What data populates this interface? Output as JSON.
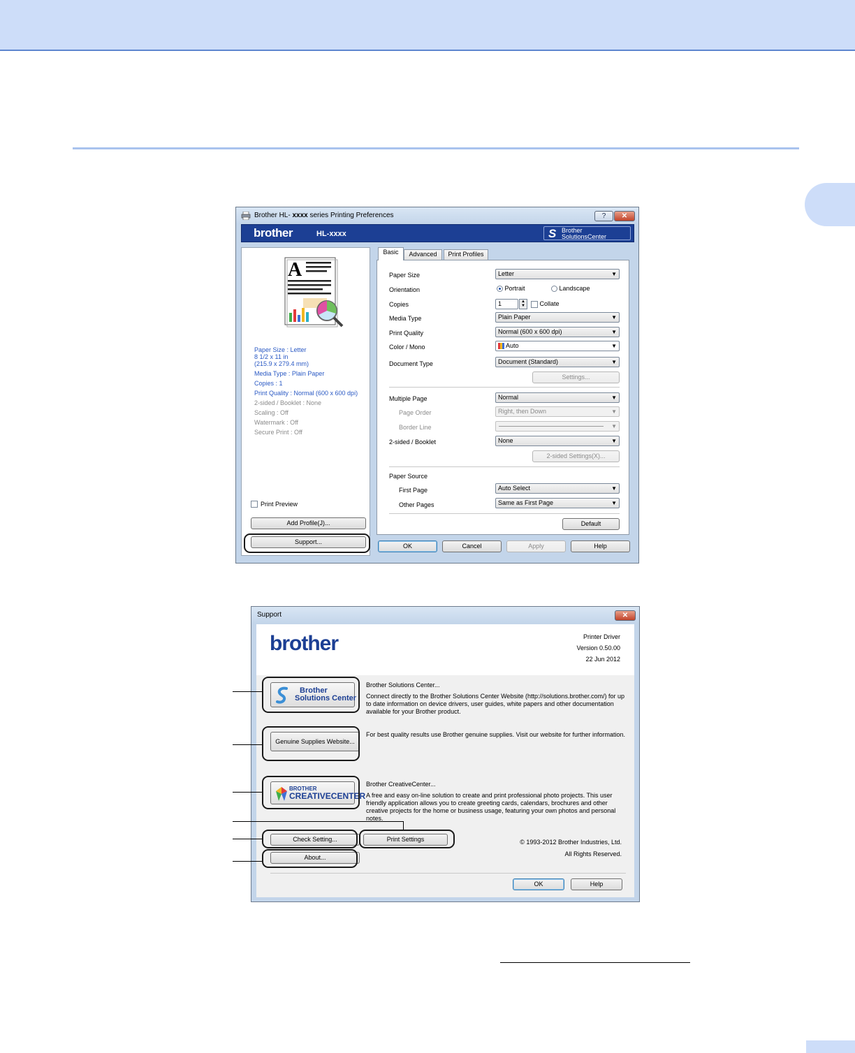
{
  "colors": {
    "header_band": "#cdddf9",
    "brand_blue": "#1c3f94",
    "link_blue": "#2a59c4"
  },
  "prefs_dialog": {
    "title_prefix": "Brother HL-",
    "title_model": "xxxx",
    "title_suffix": "series Printing Preferences",
    "help_caption": "?",
    "close_caption": "✕",
    "brand": "brother",
    "model": "HL-xxxx",
    "bsc_line1": "Brother",
    "bsc_line2": "SolutionsCenter",
    "summary": {
      "paper_size": "Paper Size : Letter",
      "dims_in": "8 1/2 x 11 in",
      "dims_mm": "(215.9 x 279.4 mm)",
      "media_type": "Media Type : Plain Paper",
      "copies": "Copies : 1",
      "print_quality": "Print Quality : Normal (600 x 600 dpi)",
      "two_sided": "2-sided / Booklet : None",
      "scaling": "Scaling : Off",
      "watermark": "Watermark : Off",
      "secure_print": "Secure Print : Off"
    },
    "print_preview": "Print Preview",
    "add_profile": "Add Profile(J)...",
    "support": "Support...",
    "tabs": [
      "Basic",
      "Advanced",
      "Print Profiles"
    ],
    "basic": {
      "paper_size_label": "Paper Size",
      "paper_size_value": "Letter",
      "orientation_label": "Orientation",
      "portrait": "Portrait",
      "landscape": "Landscape",
      "copies_label": "Copies",
      "copies_value": "1",
      "collate": "Collate",
      "media_type_label": "Media Type",
      "media_type_value": "Plain Paper",
      "print_quality_label": "Print Quality",
      "print_quality_value": "Normal (600 x 600 dpi)",
      "color_mono_label": "Color / Mono",
      "color_mono_value": "Auto",
      "document_type_label": "Document Type",
      "document_type_value": "Document (Standard)",
      "settings_button": "Settings...",
      "multiple_page_label": "Multiple Page",
      "multiple_page_value": "Normal",
      "page_order_label": "Page Order",
      "page_order_value": "Right, then Down",
      "border_line_label": "Border Line",
      "two_sided_label": "2-sided / Booklet",
      "two_sided_value": "None",
      "two_sided_settings": "2-sided Settings(X)...",
      "paper_source_label": "Paper Source",
      "first_page_label": "First Page",
      "first_page_value": "Auto Select",
      "other_pages_label": "Other Pages",
      "other_pages_value": "Same as First Page",
      "default_button": "Default"
    },
    "footer": {
      "ok": "OK",
      "cancel": "Cancel",
      "apply": "Apply",
      "help": "Help"
    }
  },
  "support_dialog": {
    "title": "Support",
    "close_caption": "✕",
    "brand": "brother",
    "printer_driver": "Printer Driver",
    "version": "Version 0.50.00",
    "date": "22 Jun 2012",
    "bsc_line1": "Brother",
    "bsc_line2": "Solutions Center",
    "bsc_heading": "Brother Solutions Center...",
    "bsc_desc": "Connect directly to the Brother Solutions Center Website (http://solutions.brother.com/) for up to date information on device drivers, user guides, white papers and other documentation available for your Brother product.",
    "genuine_button": "Genuine Supplies Website...",
    "genuine_desc": "For best quality results use Brother genuine supplies. Visit our website for further information.",
    "cc_line1": "BROTHER",
    "cc_line2": "CREATIVECENTER",
    "cc_heading": "Brother CreativeCenter...",
    "cc_desc": "A free and easy on-line solution to create and print professional photo projects. This user friendly application allows you to create greeting cards, calendars, brochures and other creative projects for the home or business usage, featuring your own photos and personal notes.",
    "check_setting": "Check Setting...",
    "print_settings": "Print Settings",
    "about": "About...",
    "copyright": "© 1993-2012 Brother Industries, Ltd.",
    "rights": "All Rights Reserved.",
    "ok": "OK",
    "help": "Help"
  }
}
